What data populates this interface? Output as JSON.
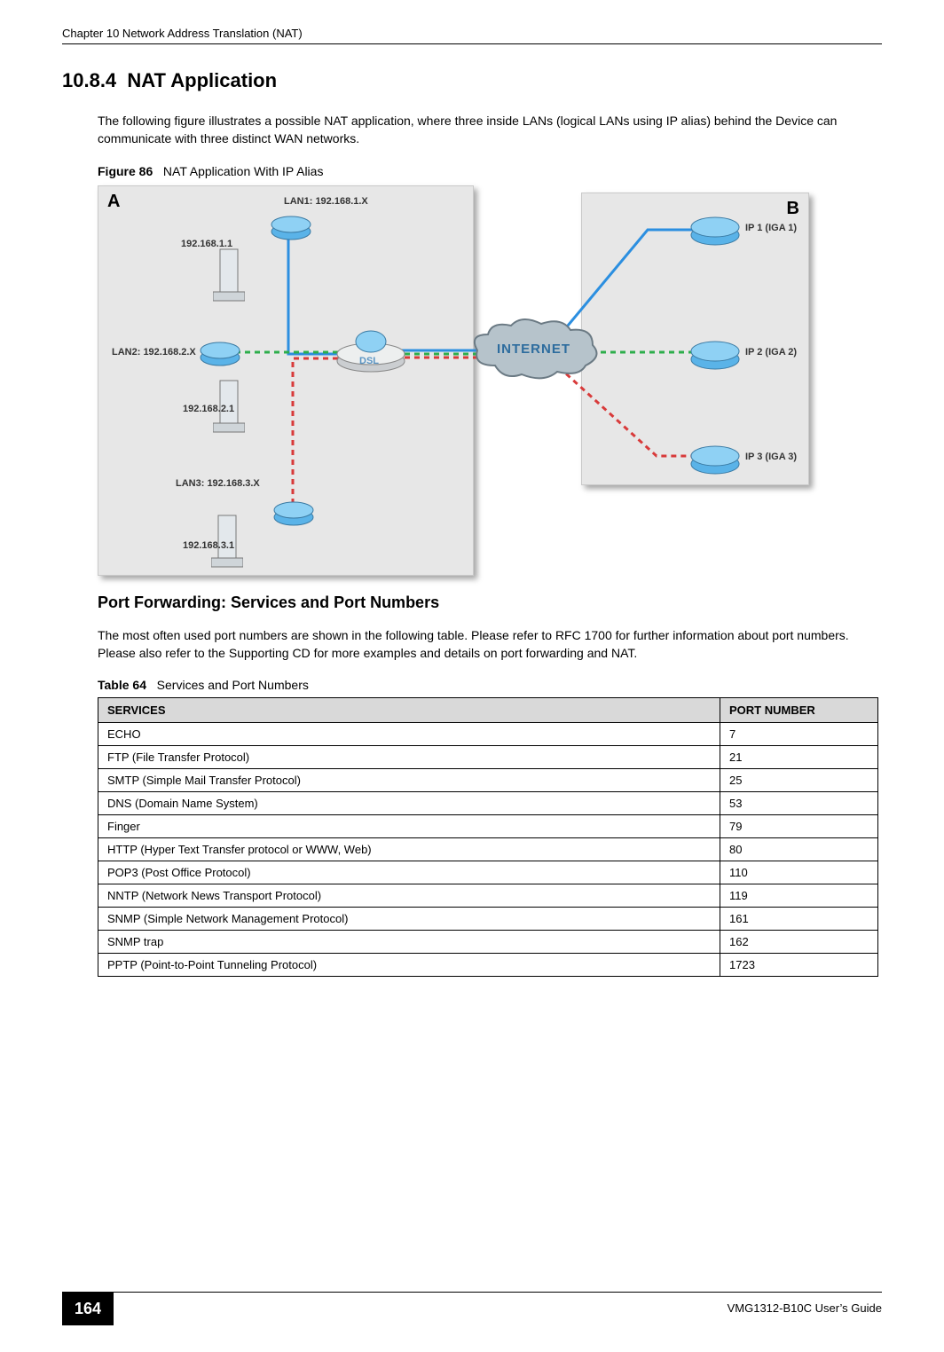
{
  "header": {
    "chapter": "Chapter 10 Network Address Translation (NAT)"
  },
  "section": {
    "number": "10.8.4",
    "title": "NAT Application",
    "intro": "The following figure illustrates a possible NAT application, where three inside LANs (logical LANs using IP alias) behind the Device can communicate with three distinct WAN networks."
  },
  "figure": {
    "label": "Figure 86",
    "caption": "NAT Application With IP Alias",
    "zoneA": "A",
    "zoneB": "B",
    "lan1_net": "LAN1: 192.168.1.X",
    "lan1_host": "192.168.1.1",
    "lan2_net": "LAN2: 192.168.2.X",
    "lan2_host": "192.168.2.1",
    "lan3_net": "LAN3: 192.168.3.X",
    "lan3_host": "192.168.3.1",
    "dsl": "DSL",
    "internet": "INTERNET",
    "ip1": "IP 1 (IGA 1)",
    "ip2": "IP 2 (IGA 2)",
    "ip3": "IP 3 (IGA 3)"
  },
  "subhead": "Port Forwarding: Services and Port Numbers",
  "paragraph2": "The most often used port numbers are shown in the following table. Please refer to RFC 1700 for further information about port numbers. Please also refer to the Supporting CD for more examples and details on port forwarding and NAT.",
  "table": {
    "label": "Table 64",
    "caption": "Services and Port Numbers",
    "headers": {
      "services": "SERVICES",
      "port": "PORT NUMBER"
    },
    "rows": [
      {
        "service": "ECHO",
        "port": "7"
      },
      {
        "service": "FTP (File Transfer Protocol)",
        "port": "21"
      },
      {
        "service": "SMTP (Simple Mail Transfer Protocol)",
        "port": "25"
      },
      {
        "service": "DNS (Domain Name System)",
        "port": "53"
      },
      {
        "service": "Finger",
        "port": "79"
      },
      {
        "service": "HTTP (Hyper Text Transfer protocol or WWW, Web)",
        "port": "80"
      },
      {
        "service": "POP3 (Post Office Protocol)",
        "port": "110"
      },
      {
        "service": "NNTP (Network News Transport Protocol)",
        "port": "119"
      },
      {
        "service": "SNMP (Simple Network Management Protocol)",
        "port": "161"
      },
      {
        "service": "SNMP trap",
        "port": "162"
      },
      {
        "service": "PPTP (Point-to-Point Tunneling Protocol)",
        "port": "1723"
      }
    ]
  },
  "footer": {
    "page": "164",
    "guide": "VMG1312-B10C User’s Guide"
  }
}
